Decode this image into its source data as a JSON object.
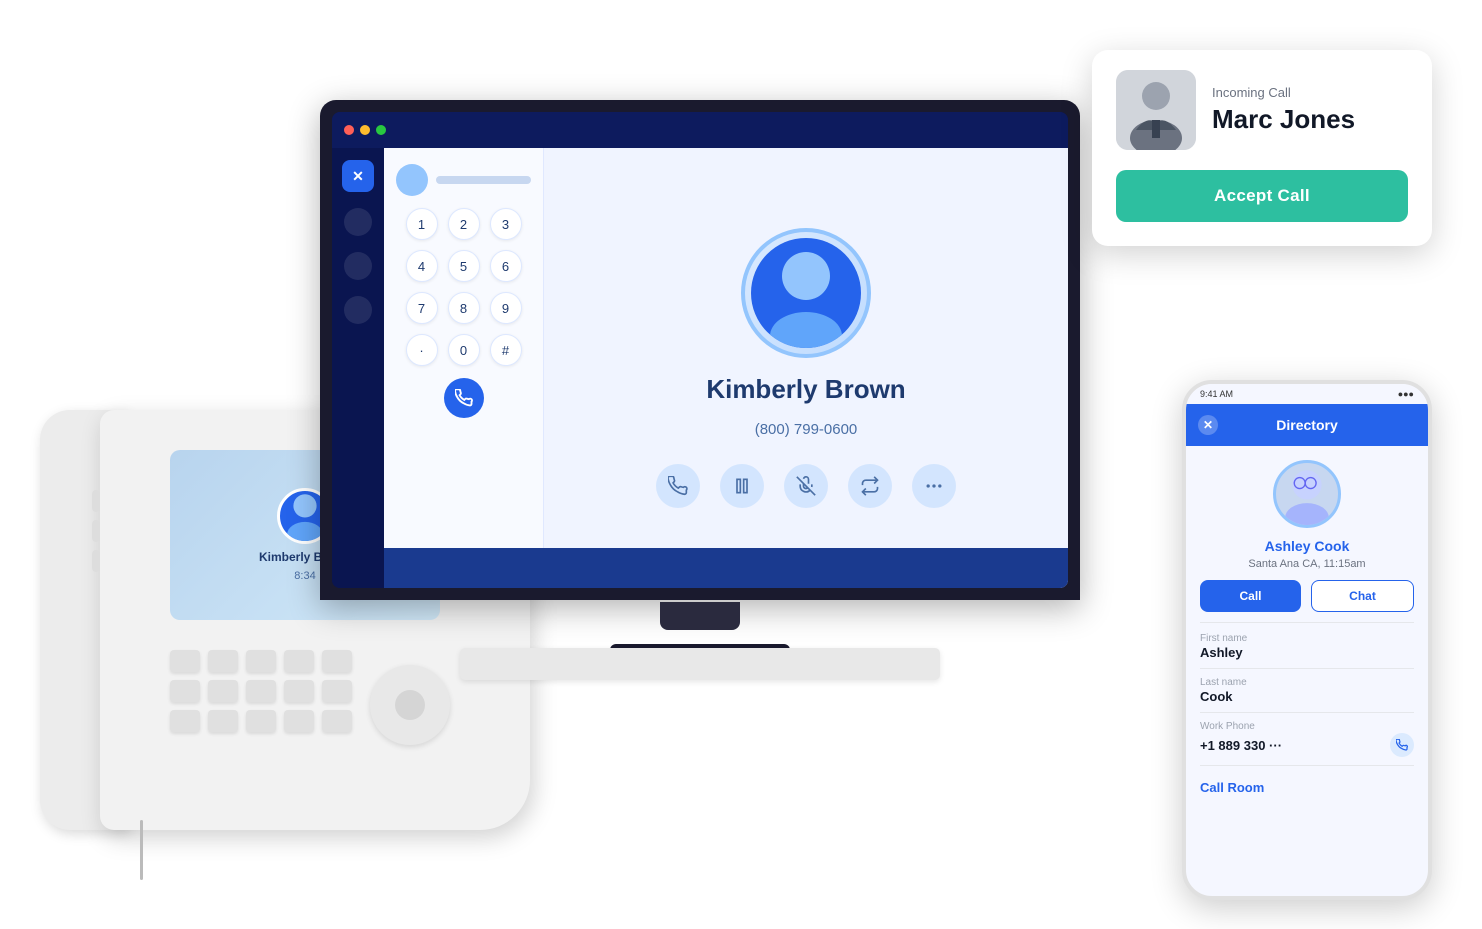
{
  "scene": {
    "background": "#ffffff"
  },
  "incoming_call": {
    "label": "Incoming Call",
    "caller_name": "Marc Jones",
    "accept_btn_label": "Accept Call"
  },
  "monitor": {
    "dial_keys": [
      "1",
      "2",
      "3",
      "4",
      "5",
      "6",
      "7",
      "8",
      "9",
      ".",
      "0",
      "#"
    ],
    "contact_name": "Kimberly Brown",
    "contact_phone": "(800) 799-0600"
  },
  "desk_phone": {
    "screen_name": "Kimberly Brown",
    "screen_status": "8:34"
  },
  "mobile_app": {
    "title": "Directory",
    "status_bar_time": "9:41 AM",
    "contact_name": "Ashley Cook",
    "contact_location": "Santa Ana CA, 11:15am",
    "call_btn": "Call",
    "chat_btn": "Chat",
    "first_name_label": "First name",
    "first_name_value": "Ashley",
    "last_name_label": "Last name",
    "last_name_value": "Cook",
    "work_phone_label": "Work Phone",
    "work_phone_value": "+1 889 330 ···",
    "call_room_btn": "Call Room"
  }
}
